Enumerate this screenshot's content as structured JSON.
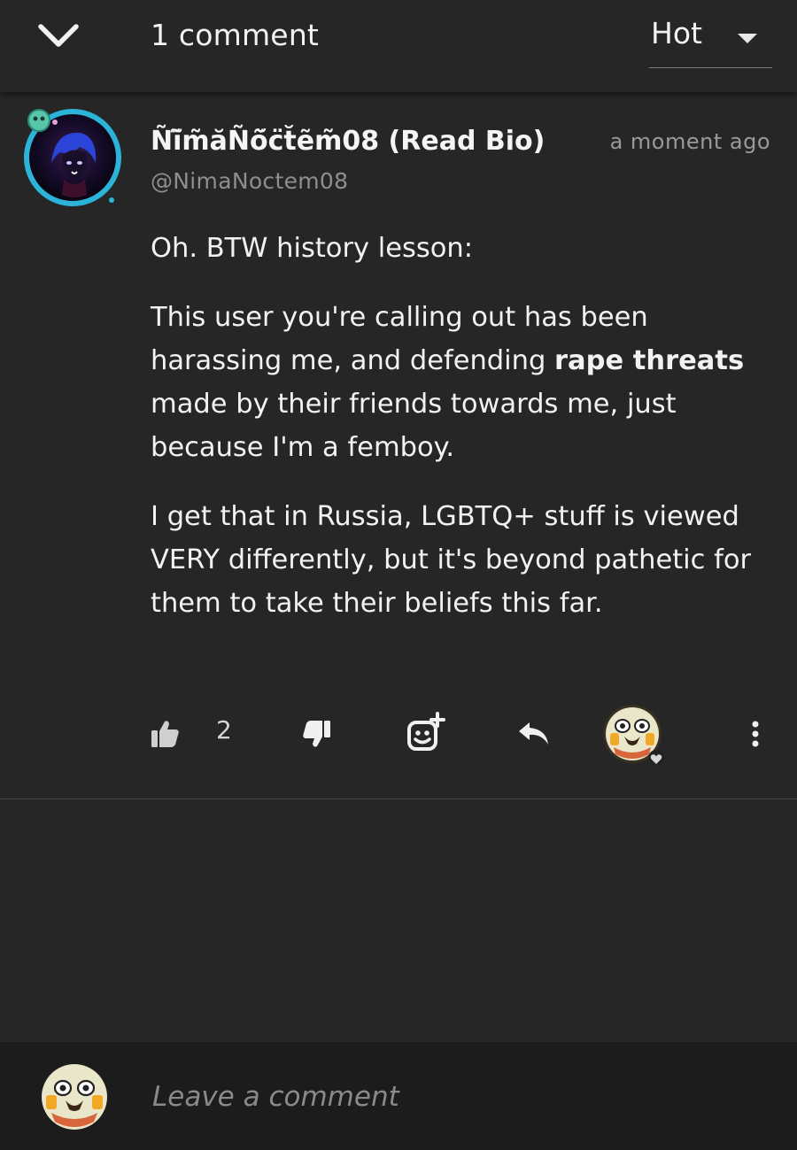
{
  "header": {
    "comment_count_label": "1 comment",
    "sort": {
      "selected": "Hot"
    }
  },
  "comment": {
    "author_name": "Ñĩ̃m̃ăÑõ̆c̈t̆ẽm̃08 (Read Bio)",
    "author_handle": "@NimaNoctem08",
    "timestamp": "a moment ago",
    "paragraphs": {
      "p1": "Oh. BTW history lesson:",
      "p2_a": "This user you're calling out has been harassing me, and defending ",
      "p2_bold": "rape threats",
      "p2_b": " made by their friends towards me, just because I'm a femboy.",
      "p3": "I get that in Russia, LGBTQ+ stuff is viewed VERY differently, but it's beyond pathetic for them to take their beliefs this far."
    },
    "likes": "2"
  },
  "footer": {
    "input_placeholder": "Leave a comment"
  },
  "icons": {
    "collapse": "chevron-down-icon",
    "sort": "caret-down-icon",
    "like": "thumbs-up-icon",
    "dislike": "thumbs-down-icon",
    "add_reaction": "add-emoji-icon",
    "reply": "reply-icon",
    "more": "more-vertical-icon",
    "reactor_badge": "heart-icon"
  },
  "colors": {
    "background": "#262626",
    "footer_background": "#1c1c1c",
    "avatar_ring": "#2bb3d8",
    "text_primary": "#f2f2f2",
    "text_muted": "#9a9a9a"
  }
}
